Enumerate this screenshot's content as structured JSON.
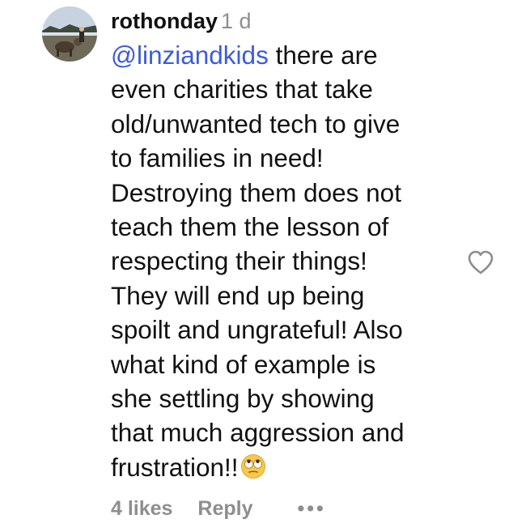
{
  "comment": {
    "username": "rothonday",
    "timestamp": "1 d",
    "mention": "@linziandkids",
    "first_line_rest": " there are",
    "lines": [
      "even charities that take",
      "old/unwanted tech to give",
      "to families in need!",
      "Destroying them does not",
      "teach them the lesson of",
      "respecting their things!",
      "They will end up being",
      "spoilt and ungrateful! Also",
      "what kind of example is",
      "she settling by showing",
      "that much aggression and"
    ],
    "last_line": "frustration!!",
    "emoji": "face-with-rolling-eyes",
    "likes_label": "4 likes",
    "reply_label": "Reply",
    "more_label": "•••",
    "like_icon": "heart-outline-icon"
  },
  "colors": {
    "mention": "#3d5bd9",
    "secondary_text": "#8e8e8e",
    "primary_text": "#111111"
  }
}
